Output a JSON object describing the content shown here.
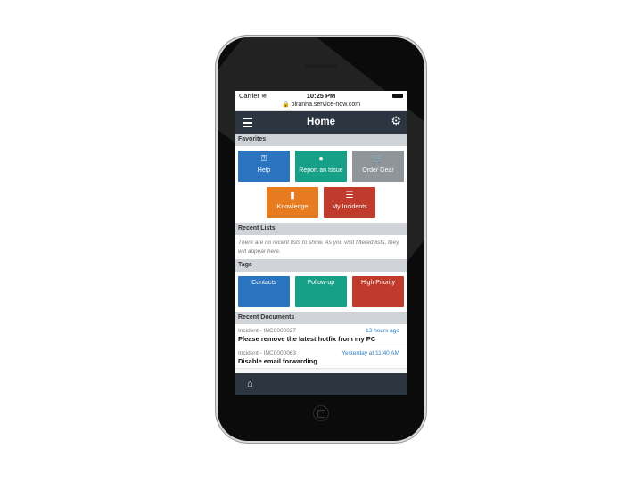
{
  "status_bar": {
    "carrier": "Carrier ≋",
    "time": "10:25 PM"
  },
  "url": "🔒 piranha.service-now.com",
  "header": {
    "title": "Home",
    "menu_icon": "hamburger-icon",
    "settings_icon": "gear-icon"
  },
  "favorites": {
    "heading": "Favorites",
    "tiles": [
      {
        "label": "Help",
        "icon": "help-icon",
        "glyph": "⍰",
        "color": "#2b74c0"
      },
      {
        "label": "Report an Issue",
        "icon": "alert-icon",
        "glyph": "●",
        "color": "#17a088"
      },
      {
        "label": "Order Gear",
        "icon": "cart-icon",
        "glyph": "🛒",
        "color": "#8f9598"
      },
      {
        "label": "Knowledge",
        "icon": "book-icon",
        "glyph": "▮",
        "color": "#e67b1f"
      },
      {
        "label": "My Incidents",
        "icon": "list-icon",
        "glyph": "☰",
        "color": "#c03b2b"
      }
    ]
  },
  "recent_lists": {
    "heading": "Recent Lists",
    "empty_text": "There are no recent lists to show. As you visit filtered lists, they will appear here."
  },
  "tags": {
    "heading": "Tags",
    "items": [
      {
        "label": "Contacts",
        "color": "#2b74c0"
      },
      {
        "label": "Follow-up",
        "color": "#17a088"
      },
      {
        "label": "High Priority",
        "color": "#c03b2b"
      }
    ]
  },
  "recent_documents": {
    "heading": "Recent Documents",
    "items": [
      {
        "meta": "Incident - INC0000027",
        "when": "13 hours ago",
        "title": "Please remove the latest hotfix from my PC"
      },
      {
        "meta": "Incident - INC0000063",
        "when": "Yesterday at 11:40 AM",
        "title": "Disable email forwarding"
      }
    ]
  },
  "bottom_bar": {
    "home_icon": "home-icon"
  }
}
